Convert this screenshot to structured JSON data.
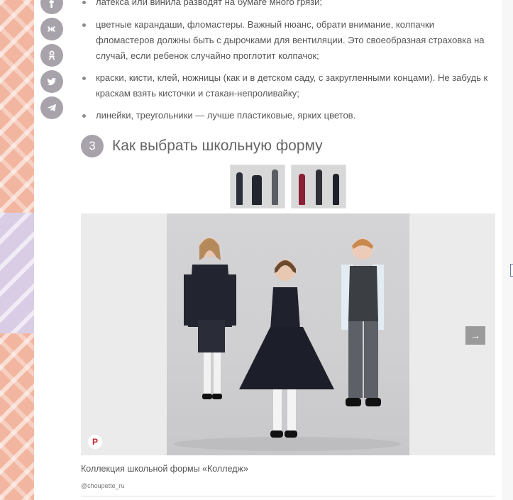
{
  "social": {
    "icons": [
      "facebook-icon",
      "vk-icon",
      "odnoklassniki-icon",
      "twitter-icon",
      "telegram-icon"
    ],
    "labels": [
      "f",
      "vk",
      "ok"
    ]
  },
  "article": {
    "first_line": "латекса или винила разводят на бумаге много грязи;",
    "bullets": [
      "цветные карандаши, фломастеры.  Важный нюанс, обрати внимание, колпачки фломастеров должны быть с дырочками для вентиляции.  Это своеобразная страховка на случай, если ребенок случайно проглотит колпачок;",
      "краски, кисти, клей, ножницы (как и в детском саду, с закругленными концами). Не забудь к краскам взять кисточки и стакан-непроливайку;",
      "линейки, треугольники — лучше пластиковые, ярких цветов."
    ],
    "section": {
      "number": "3",
      "title": "Как выбрать школьную форму"
    }
  },
  "gallery": {
    "caption": "Коллекция школьной формы «Колледж»",
    "credit": "@choupette_ru",
    "pin_label": "P",
    "next_label": "→"
  },
  "colors": {
    "accent_gray": "#a8a2ab",
    "page_bg": "#ffffff",
    "backdrop": "#f2b6a0"
  }
}
